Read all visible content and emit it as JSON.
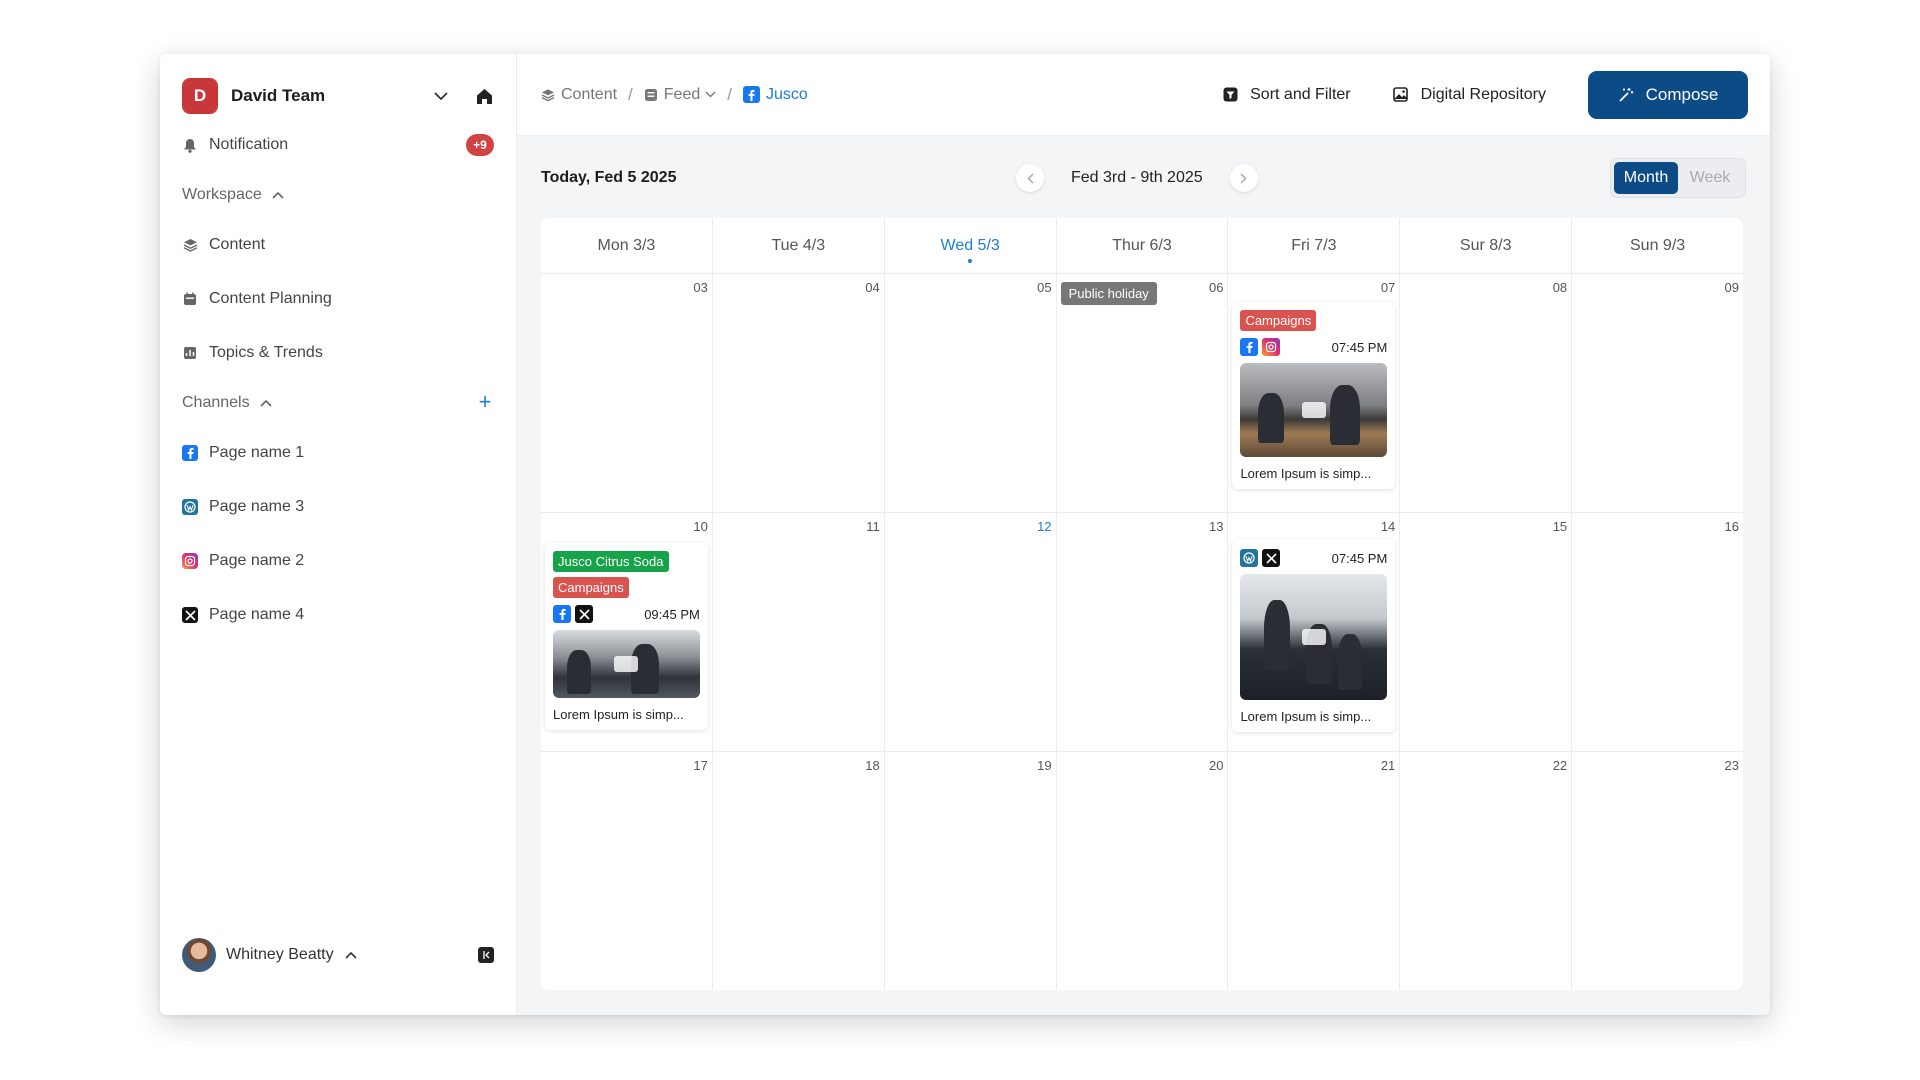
{
  "sidebar": {
    "team": {
      "initial": "D",
      "name": "David Team"
    },
    "notification": {
      "label": "Notification",
      "badge": "+9"
    },
    "workspace": {
      "heading": "Workspace",
      "items": [
        {
          "label": "Content",
          "icon": "layers-icon"
        },
        {
          "label": "Content Planning",
          "icon": "calendar-icon"
        },
        {
          "label": "Topics & Trends",
          "icon": "chart-icon"
        }
      ]
    },
    "channels": {
      "heading": "Channels",
      "items": [
        {
          "label": "Page name 1",
          "icon": "facebook-icon"
        },
        {
          "label": "Page name 3",
          "icon": "wordpress-icon"
        },
        {
          "label": "Page name 2",
          "icon": "instagram-icon"
        },
        {
          "label": "Page name 4",
          "icon": "x-icon"
        }
      ]
    },
    "user": {
      "name": "Whitney Beatty"
    }
  },
  "breadcrumb": {
    "items": [
      {
        "label": "Content",
        "icon": "layers-icon"
      },
      {
        "label": "Feed",
        "icon": "feed-icon"
      },
      {
        "label": "Jusco",
        "icon": "facebook-icon"
      }
    ],
    "separator": "/"
  },
  "toolbar": {
    "sort_filter": "Sort and Filter",
    "repository": "Digital Repository",
    "compose": "Compose"
  },
  "calendar": {
    "today_label": "Today, Fed 5 2025",
    "range": "Fed 3rd - 9th 2025",
    "views": [
      "Month",
      "Week"
    ],
    "active_view": "Month",
    "days": [
      "Mon 3/3",
      "Tue 4/3",
      "Wed 5/3",
      "Thur 6/3",
      "Fri 7/3",
      "Sur 8/3",
      "Sun 9/3"
    ],
    "weeks": [
      [
        "03",
        "04",
        "05",
        "06",
        "07",
        "08",
        "09"
      ],
      [
        "10",
        "11",
        "12",
        "13",
        "14",
        "15",
        "16"
      ],
      [
        "17",
        "18",
        "19",
        "20",
        "21",
        "22",
        "23"
      ]
    ],
    "holiday": "Public holiday",
    "posts": [
      {
        "tags": [
          "Campaigns"
        ],
        "time": "07:45 PM",
        "text": "Lorem Ipsum is simp..."
      },
      {
        "tags": [
          "Jusco Citrus Soda",
          "Campaigns"
        ],
        "time": "09:45 PM",
        "text": "Lorem Ipsum is simp..."
      },
      {
        "tags": [],
        "time": "07:45 PM",
        "text": "Lorem Ipsum is simp..."
      }
    ]
  },
  "colors": {
    "brand": "#0d4b86",
    "accent": "#1c7ed6",
    "badge": "#d14343",
    "tag_green": "#17a34a",
    "tag_red": "#d9534f"
  }
}
